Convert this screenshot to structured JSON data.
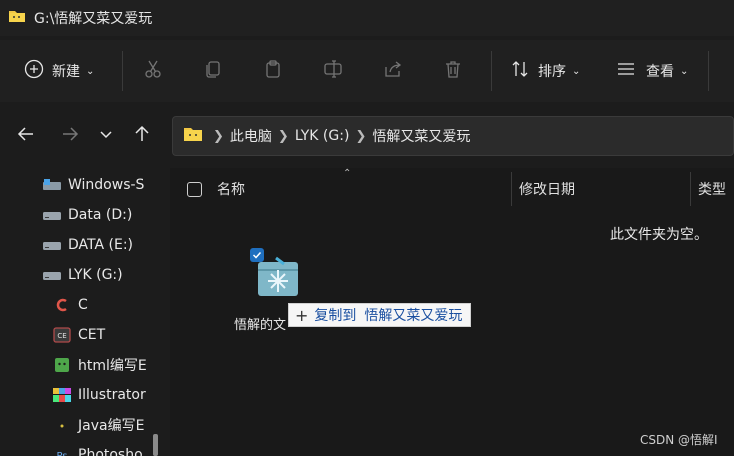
{
  "window": {
    "title": "G:\\悟解又菜又爱玩"
  },
  "toolbar": {
    "new_label": "新建",
    "sort_label": "排序",
    "view_label": "查看",
    "icons": [
      "new-icon",
      "cut-icon",
      "copy-icon",
      "paste-icon",
      "rename-icon",
      "share-icon",
      "delete-icon",
      "sort-icon",
      "view-icon"
    ]
  },
  "address": {
    "crumbs": [
      "此电脑",
      "LYK (G:)",
      "悟解又菜又爱玩"
    ]
  },
  "sidebar": {
    "items": [
      {
        "label": "Windows-S",
        "icon": "drive-os-icon"
      },
      {
        "label": "Data (D:)",
        "icon": "drive-icon"
      },
      {
        "label": "DATA (E:)",
        "icon": "drive-icon"
      },
      {
        "label": "LYK (G:)",
        "icon": "drive-icon"
      },
      {
        "label": "C",
        "icon": "c-app-icon"
      },
      {
        "label": "CET",
        "icon": "cet-folder-icon"
      },
      {
        "label": "html编写E",
        "icon": "html-folder-icon"
      },
      {
        "label": "Illustrator",
        "icon": "illustrator-folder-icon"
      },
      {
        "label": "Java编写E",
        "icon": "java-folder-icon"
      },
      {
        "label": "Photosho",
        "icon": "photoshop-folder-icon"
      }
    ]
  },
  "columns": {
    "name": "名称",
    "modified": "修改日期",
    "type": "类型"
  },
  "content": {
    "empty_message": "此文件夹为空。",
    "drag_item_label": "悟解的文",
    "drop_tooltip_prefix": "复制到",
    "drop_tooltip_target": "悟解又菜又爱玩"
  },
  "watermark": "CSDN @悟解I"
}
